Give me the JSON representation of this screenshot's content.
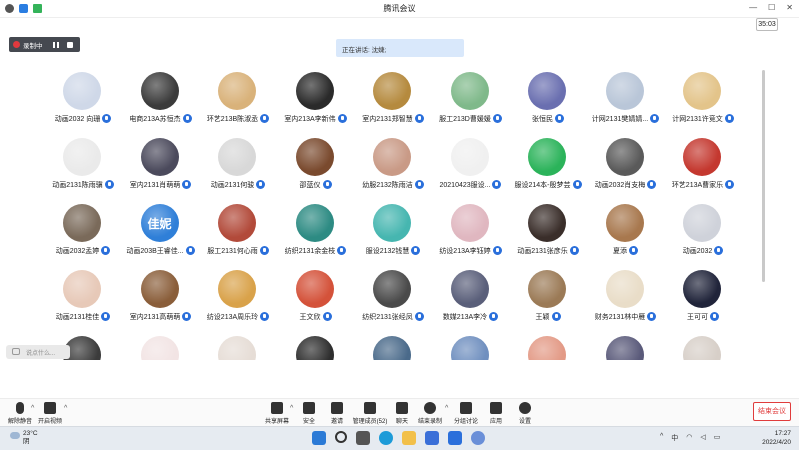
{
  "window": {
    "title": "腾讯会议",
    "timer": "35:03"
  },
  "recording": {
    "label": "录制中"
  },
  "speaker": {
    "text": "正在讲话: 沈婕;"
  },
  "participants": [
    {
      "name": "动画2032 向珊",
      "color": "#cfd8e8",
      "initial": ""
    },
    {
      "name": "电商213A苏恒杰",
      "color": "#3b3b3b",
      "initial": ""
    },
    {
      "name": "环艺213B陈淑丞",
      "color": "#d9b27a",
      "initial": ""
    },
    {
      "name": "室内213A李新伟",
      "color": "#2a2a2a",
      "initial": ""
    },
    {
      "name": "室内2131郑智慧",
      "color": "#b58a3e",
      "initial": ""
    },
    {
      "name": "服工213D曹媛媛",
      "color": "#7fb98a",
      "initial": ""
    },
    {
      "name": "张恒民",
      "color": "#6a6fb0",
      "initial": ""
    },
    {
      "name": "计网2131樊婧婧...",
      "color": "#b9c6d8",
      "initial": ""
    },
    {
      "name": "计网2131许竞文",
      "color": "#e3c48a",
      "initial": ""
    },
    {
      "name": "动画2131陈雨骥",
      "color": "#eaeaea",
      "initial": ""
    },
    {
      "name": "室内2131肖萌萌",
      "color": "#4b4a5c",
      "initial": ""
    },
    {
      "name": "动画2131何骏",
      "color": "#d8d8d8",
      "initial": ""
    },
    {
      "name": "邵蓝仪",
      "color": "#7a4a2e",
      "initial": ""
    },
    {
      "name": "幼服2132陈雨洁",
      "color": "#c99a86",
      "initial": ""
    },
    {
      "name": "20210423服设...",
      "color": "#f0f0f0",
      "initial": ""
    },
    {
      "name": "服设214本-殷梦芸",
      "color": "#2bb35a",
      "initial": ""
    },
    {
      "name": "动画2032肖支梅",
      "color": "#5a5a5a",
      "initial": ""
    },
    {
      "name": "环艺213A曹家乐",
      "color": "#c4382f",
      "initial": ""
    },
    {
      "name": "动画2032孟婷",
      "color": "#7a6a5a",
      "initial": ""
    },
    {
      "name": "动画203B王睿佳...",
      "color": "#2f7fd8",
      "initial": "佳妮"
    },
    {
      "name": "服工2131何心雨",
      "color": "#b24a3a",
      "initial": ""
    },
    {
      "name": "纺织2131余金枝",
      "color": "#2d8b83",
      "initial": ""
    },
    {
      "name": "服设2132钱慧",
      "color": "#46b6b0",
      "initial": ""
    },
    {
      "name": "纺设213A李钰婷",
      "color": "#e0b7c0",
      "initial": ""
    },
    {
      "name": "动画2131张彦乐",
      "color": "#3a2e2a",
      "initial": ""
    },
    {
      "name": "夏添",
      "color": "#a8784e",
      "initial": ""
    },
    {
      "name": "动画2032",
      "color": "#cfd2da",
      "initial": ""
    },
    {
      "name": "动画2131桂佳",
      "color": "#e7c9b8",
      "initial": ""
    },
    {
      "name": "室内2131高萌萌",
      "color": "#8a5e3a",
      "initial": ""
    },
    {
      "name": "纺设213A周乐玲",
      "color": "#d9a24a",
      "initial": ""
    },
    {
      "name": "王文欣",
      "color": "#d4523a",
      "initial": ""
    },
    {
      "name": "纺织2131张经凤",
      "color": "#4a4a4a",
      "initial": ""
    },
    {
      "name": "数媒213A李冷",
      "color": "#5a5f7a",
      "initial": ""
    },
    {
      "name": "王颖",
      "color": "#9b7a56",
      "initial": ""
    },
    {
      "name": "财务2131林中雁",
      "color": "#e9ddc8",
      "initial": ""
    },
    {
      "name": "王可可",
      "color": "#20243a",
      "initial": ""
    },
    {
      "name": "",
      "color": "#3b3b3b",
      "initial": ""
    },
    {
      "name": "",
      "color": "#f2e4e4",
      "initial": ""
    },
    {
      "name": "",
      "color": "#e6ddd6",
      "initial": ""
    },
    {
      "name": "",
      "color": "#2e2e2e",
      "initial": ""
    },
    {
      "name": "",
      "color": "#4a6a8a",
      "initial": ""
    },
    {
      "name": "",
      "color": "#6f8fbf",
      "initial": ""
    },
    {
      "name": "",
      "color": "#e39a86",
      "initial": ""
    },
    {
      "name": "",
      "color": "#5a5a7a",
      "initial": ""
    },
    {
      "name": "",
      "color": "#d7cfc8",
      "initial": ""
    }
  ],
  "chat": {
    "placeholder": "说点什么..."
  },
  "toolbar": {
    "unmute": "解除静音",
    "start_video": "开启视频",
    "share": "共享屏幕",
    "security": "安全",
    "invite": "邀请",
    "members": "管理成员(52)",
    "chat": "聊天",
    "record": "结束录制",
    "breakout": "分组讨论",
    "apps": "应用",
    "settings": "设置",
    "end": "结束会议"
  },
  "taskbar": {
    "temp": "23°C",
    "weather": "阴",
    "ime": "中",
    "time": "17:27",
    "date": "2022/4/20"
  }
}
